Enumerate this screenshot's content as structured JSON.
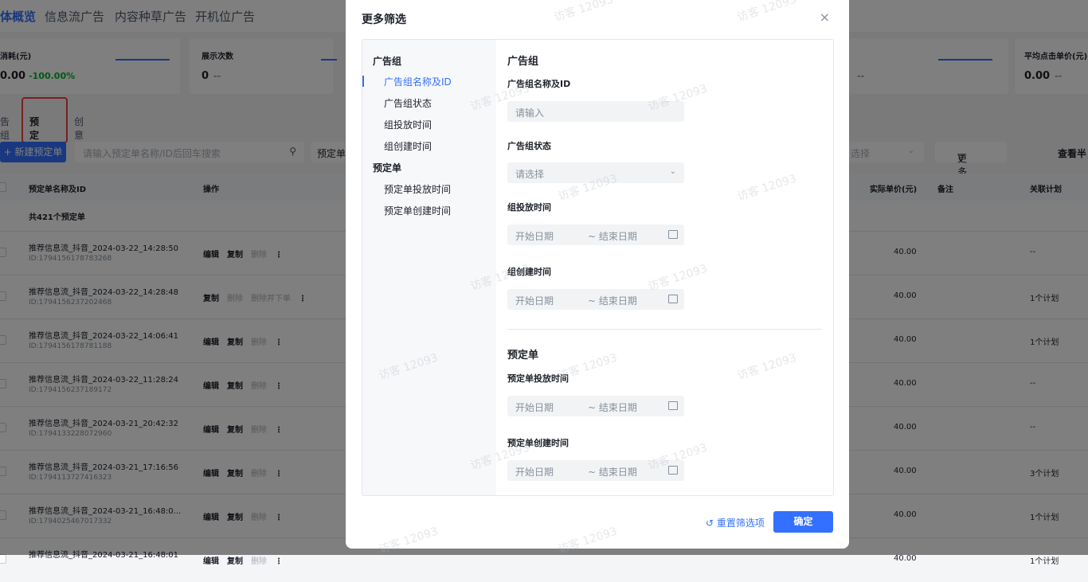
{
  "topnav": {
    "tabs": [
      "体概览",
      "信息流广告",
      "内容种草广告",
      "开机位广告"
    ]
  },
  "metrics": [
    {
      "label": "消耗(元)",
      "value": "0.00",
      "change": "-100.00%"
    },
    {
      "label": "展示次数",
      "value": "0",
      "change": "--"
    },
    {
      "label": "",
      "value": "",
      "change": "--"
    },
    {
      "label": "平均点击单价(元)",
      "value": "0.00",
      "change": "--"
    }
  ],
  "subtabs": {
    "group": "告组",
    "booking": "预定单",
    "creative": "创意"
  },
  "toolbar": {
    "new_button": "+ 新建预定单",
    "search_placeholder": "请输入预定单名称/ID后回车搜索",
    "filter_label": "预定单",
    "select_placeholder": "选择",
    "more_filter": "更多筛选",
    "view_half": "查看半"
  },
  "table": {
    "headers": {
      "name": "预定单名称及ID",
      "ops": "操作",
      "price": "实际单价(元)",
      "remark": "备注",
      "plan": "关联计划"
    },
    "count": "共421个预定单",
    "rows": [
      {
        "name": "推荐信息流_抖音_2024-03-22_14:28:50",
        "id": "ID:1794156178783268",
        "ops": [
          "编辑",
          "复制",
          "删除",
          "⋮"
        ],
        "price": "40.00",
        "plan": "--"
      },
      {
        "name": "推荐信息流_抖音_2024-03-22_14:28:48",
        "id": "ID:1794156237202468",
        "ops": [
          "复制",
          "删除",
          "删除并下单",
          "⋮"
        ],
        "price": "40.00",
        "plan": "1个计划"
      },
      {
        "name": "推荐信息流_抖音_2024-03-22_14:06:41",
        "id": "ID:1794156178781188",
        "ops": [
          "编辑",
          "复制",
          "删除",
          "⋮"
        ],
        "price": "40.00",
        "plan": "1个计划"
      },
      {
        "name": "推荐信息流_抖音_2024-03-22_11:28:24",
        "id": "ID:1794156237189172",
        "ops": [
          "编辑",
          "复制",
          "删除",
          "⋮"
        ],
        "price": "40.00",
        "plan": "--"
      },
      {
        "name": "推荐信息流_抖音_2024-03-21_20:42:32",
        "id": "ID:1794133228072960",
        "ops": [
          "编辑",
          "复制",
          "删除",
          "⋮"
        ],
        "price": "40.00",
        "plan": "--"
      },
      {
        "name": "推荐信息流_抖音_2024-03-21_17:16:56",
        "id": "ID:1794113727416323",
        "ops": [
          "编辑",
          "复制",
          "删除",
          "⋮"
        ],
        "price": "40.00",
        "plan": "3个计划"
      },
      {
        "name": "推荐信息流_抖音_2024-03-21_16:48:0...",
        "id": "ID:1794025467017332",
        "ops": [
          "编辑",
          "复制",
          "删除",
          "⋮"
        ],
        "price": "40.00",
        "plan": "1个计划"
      },
      {
        "name": "推荐信息流_抖音_2024-03-21_16:48:01",
        "id": "",
        "ops": [
          "编辑",
          "复制",
          "删除",
          "⋮"
        ],
        "price": "40.00",
        "plan": "1个计划"
      }
    ]
  },
  "modal": {
    "title": "更多筛选",
    "close": "×",
    "nav": {
      "group1": "广告组",
      "items1": [
        "广告组名称及ID",
        "广告组状态",
        "组投放时间",
        "组创建时间"
      ],
      "group2": "预定单",
      "items2": [
        "预定单投放时间",
        "预定单创建时间"
      ]
    },
    "form": {
      "section1": "广告组",
      "name_label": "广告组名称及ID",
      "name_placeholder": "请输入",
      "status_label": "广告组状态",
      "status_placeholder": "请选择",
      "deliver_label": "组投放时间",
      "create_label": "组创建时间",
      "section2": "预定单",
      "booking_deliver_label": "预定单投放时间",
      "booking_create_label": "预定单创建时间",
      "start_placeholder": "开始日期",
      "end_placeholder": "~ 结束日期"
    },
    "reset": "重置筛选项",
    "confirm": "确定"
  },
  "watermark": "访客 12093",
  "colors": {
    "accent": "#3370ff",
    "highlight_box": "#f53f3f",
    "positive": "#00b42a"
  }
}
